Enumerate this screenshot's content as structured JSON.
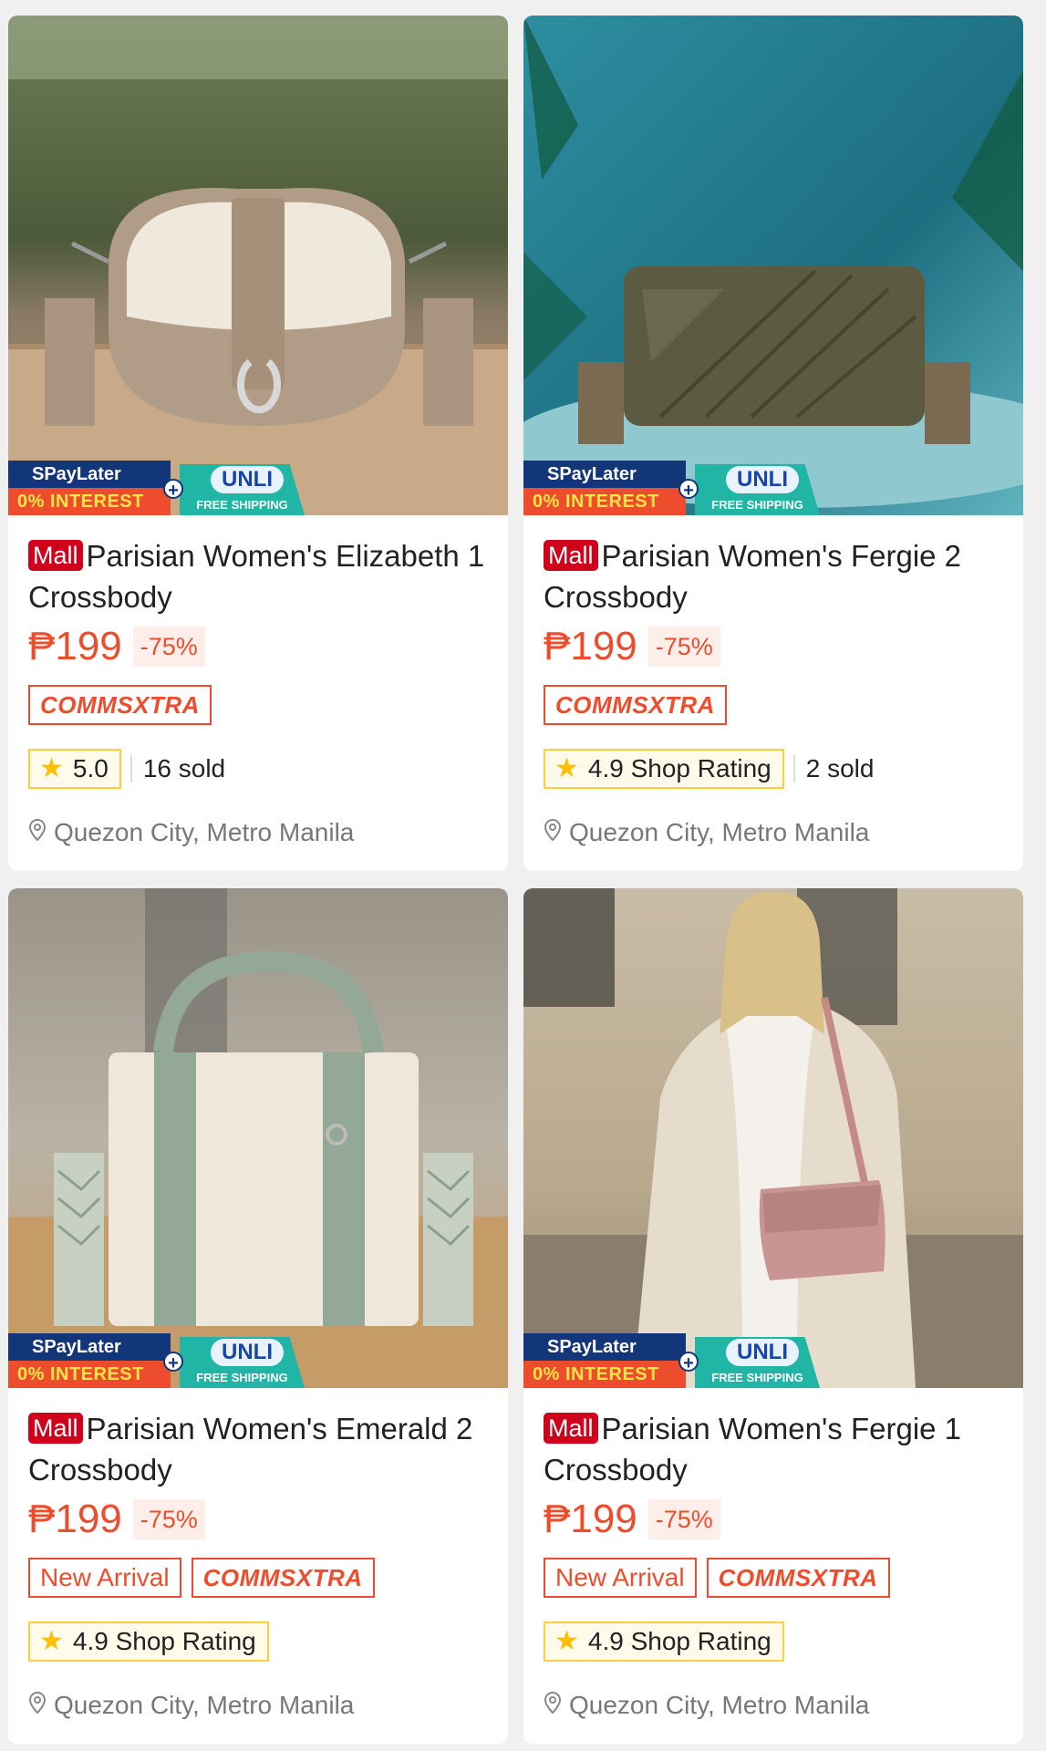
{
  "products": [
    {
      "mall_label": "Mall",
      "title": "Parisian Women's Elizabeth 1 Crossbody",
      "price": "₱199",
      "discount": "-75%",
      "tags": [
        "COMMSXTRA"
      ],
      "rating": "5.0",
      "sold": "16 sold",
      "location": "Quezon City, Metro Manila",
      "promo": {
        "spay": "SPayLater",
        "interest": "0% INTEREST",
        "unli": "UNLI",
        "free": "FREE SHIPPING"
      }
    },
    {
      "mall_label": "Mall",
      "title": "Parisian Women's Fergie 2 Crossbody",
      "price": "₱199",
      "discount": "-75%",
      "tags": [
        "COMMSXTRA"
      ],
      "rating": "4.9 Shop Rating",
      "sold": "2 sold",
      "location": "Quezon City, Metro Manila",
      "promo": {
        "spay": "SPayLater",
        "interest": "0% INTEREST",
        "unli": "UNLI",
        "free": "FREE SHIPPING"
      }
    },
    {
      "mall_label": "Mall",
      "title": "Parisian Women's Emerald 2 Crossbody",
      "price": "₱199",
      "discount": "-75%",
      "tags": [
        "New Arrival",
        "COMMSXTRA"
      ],
      "rating": "4.9 Shop Rating",
      "sold": "",
      "location": "Quezon City, Metro Manila",
      "promo": {
        "spay": "SPayLater",
        "interest": "0% INTEREST",
        "unli": "UNLI",
        "free": "FREE SHIPPING"
      }
    },
    {
      "mall_label": "Mall",
      "title": "Parisian Women's Fergie 1 Crossbody",
      "price": "₱199",
      "discount": "-75%",
      "tags": [
        "New Arrival",
        "COMMSXTRA"
      ],
      "rating": "4.9 Shop Rating",
      "sold": "",
      "location": "Quezon City, Metro Manila",
      "promo": {
        "spay": "SPayLater",
        "interest": "0% INTEREST",
        "unli": "UNLI",
        "free": "FREE SHIPPING"
      }
    }
  ],
  "colors": {
    "accent": "#ee4d2d",
    "mall_red": "#d0011b",
    "rating_border": "#ffce3d",
    "spay_blue": "#13367a",
    "unli_teal": "#21b5a6"
  },
  "icons": {
    "star": "star-icon",
    "location": "location-pin-icon",
    "plus": "plus-icon"
  }
}
